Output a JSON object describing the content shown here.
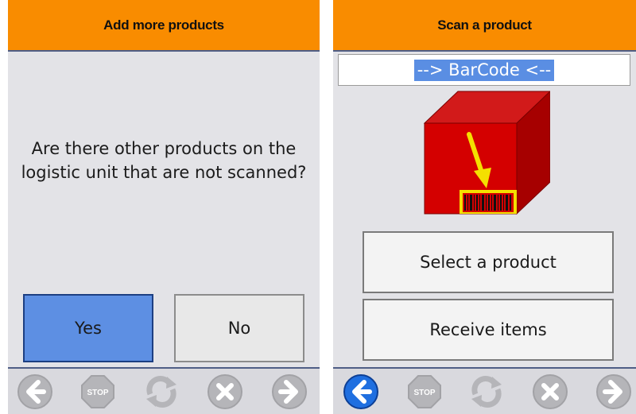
{
  "left_screen": {
    "title": "Add more products",
    "question": "Are there other products on the logistic unit that are not scanned?",
    "yes_label": "Yes",
    "no_label": "No"
  },
  "right_screen": {
    "title": "Scan a product",
    "barcode_field_value": "--> BarCode <--",
    "select_product_label": "Select a product",
    "receive_items_label": "Receive items"
  },
  "nav_icons": [
    "back-arrow-icon",
    "stop-icon",
    "refresh-icon",
    "cancel-icon",
    "forward-arrow-icon"
  ],
  "colors": {
    "header": "#f98c00",
    "yes_button": "#5d8fe3",
    "selected_text": "#5a8ee3",
    "active_back_icon": "#1f6fe0",
    "box": "#d40000"
  }
}
